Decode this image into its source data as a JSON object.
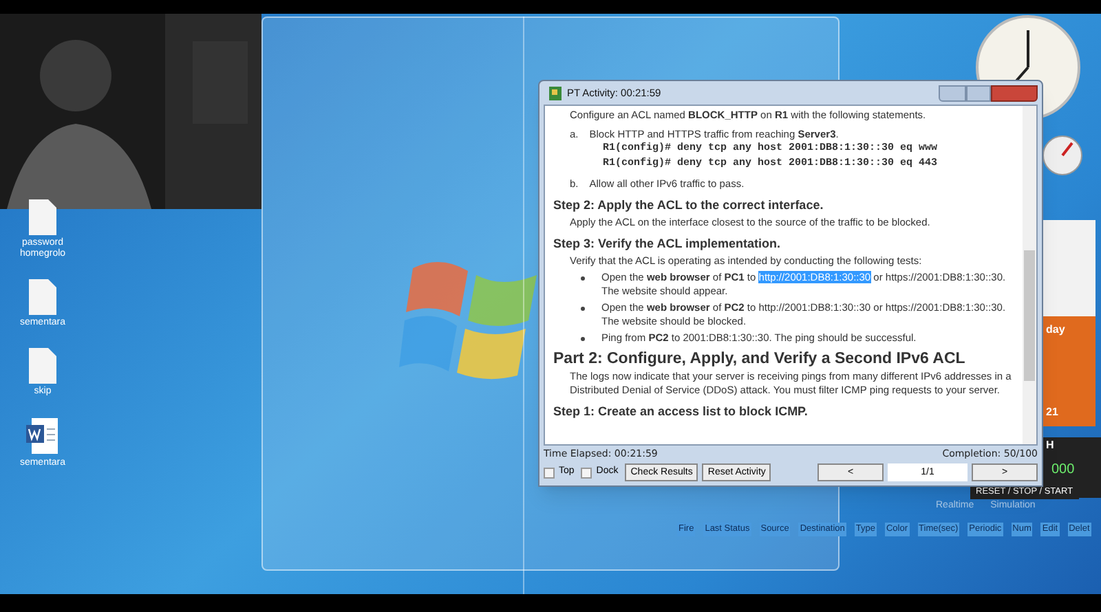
{
  "desktop_icons": [
    {
      "label": "password homegrolo",
      "kind": "file"
    },
    {
      "label": "sementara",
      "kind": "file"
    },
    {
      "label": "skip",
      "kind": "file"
    },
    {
      "label": "sementara",
      "kind": "word"
    }
  ],
  "activity_window": {
    "title": "PT Activity: 00:21:59",
    "content": [
      {
        "kind": "text",
        "text": "Configure an ACL named **BLOCK_HTTP** on **R1** with the following statements."
      },
      {
        "kind": "lettered",
        "marker": "a.",
        "text": "Block HTTP and HTTPS traffic from reaching **Server3**."
      },
      {
        "kind": "code",
        "text": "R1(config)# deny tcp any host 2001:DB8:1:30::30 eq www"
      },
      {
        "kind": "code",
        "text": "R1(config)# deny tcp any host 2001:DB8:1:30::30 eq 443"
      },
      {
        "kind": "lettered",
        "marker": "b.",
        "text": "Allow all other IPv6 traffic to pass."
      },
      {
        "kind": "step",
        "text": "Step 2:   Apply the ACL to the correct interface."
      },
      {
        "kind": "paragraph",
        "text": "Apply the ACL on the interface closest to the source of the traffic to be blocked."
      },
      {
        "kind": "step",
        "text": "Step 3:   Verify the ACL implementation."
      },
      {
        "kind": "paragraph",
        "text": "Verify that the ACL is operating as intended by conducting the following tests:"
      },
      {
        "kind": "bullet",
        "text": "Open the **web browser** of **PC1** to ",
        "link": "http://2001:DB8:1:30::30",
        "after": " or https://2001:DB8:1:30::30. The website should appear."
      },
      {
        "kind": "bullet",
        "text": "Open the **web browser** of **PC2** to http://2001:DB8:1:30::30 or https://2001:DB8:1:30::30. The website should be blocked."
      },
      {
        "kind": "bullet",
        "text": "Ping from **PC2** to 2001:DB8:1:30::30. The ping should be successful."
      },
      {
        "kind": "part",
        "text": "Part 2:  Configure, Apply, and Verify a Second IPv6 ACL"
      },
      {
        "kind": "paragraph",
        "text": "The logs now indicate that your server is receiving pings from many different IPv6 addresses in a Distributed Denial of Service (DDoS) attack. You must filter ICMP ping requests to your server."
      },
      {
        "kind": "step",
        "text": "Step 1:   Create an access list to block ICMP."
      }
    ],
    "time_elapsed": "Time Elapsed: 00:21:59",
    "completion": "Completion: 50/100",
    "checkboxes": [
      {
        "label": "Top",
        "checked": false
      },
      {
        "label": "Dock",
        "checked": false
      }
    ],
    "buttons": [
      "Check Results",
      "Reset Activity"
    ],
    "prev": "<",
    "page": "1/1",
    "next": ">"
  },
  "calendar": {
    "day_name": "day",
    "date": "21"
  },
  "stopwatch": {
    "header": "H",
    "reading": "000",
    "controls": "RESET / STOP / START"
  },
  "background_app": {
    "modes": [
      "Realtime",
      "Simulation"
    ],
    "pdu_columns": [
      "Fire",
      "Last Status",
      "Source",
      "Destination",
      "Type",
      "Color",
      "Time(sec)",
      "Periodic",
      "Num",
      "Edit",
      "Delet"
    ]
  }
}
